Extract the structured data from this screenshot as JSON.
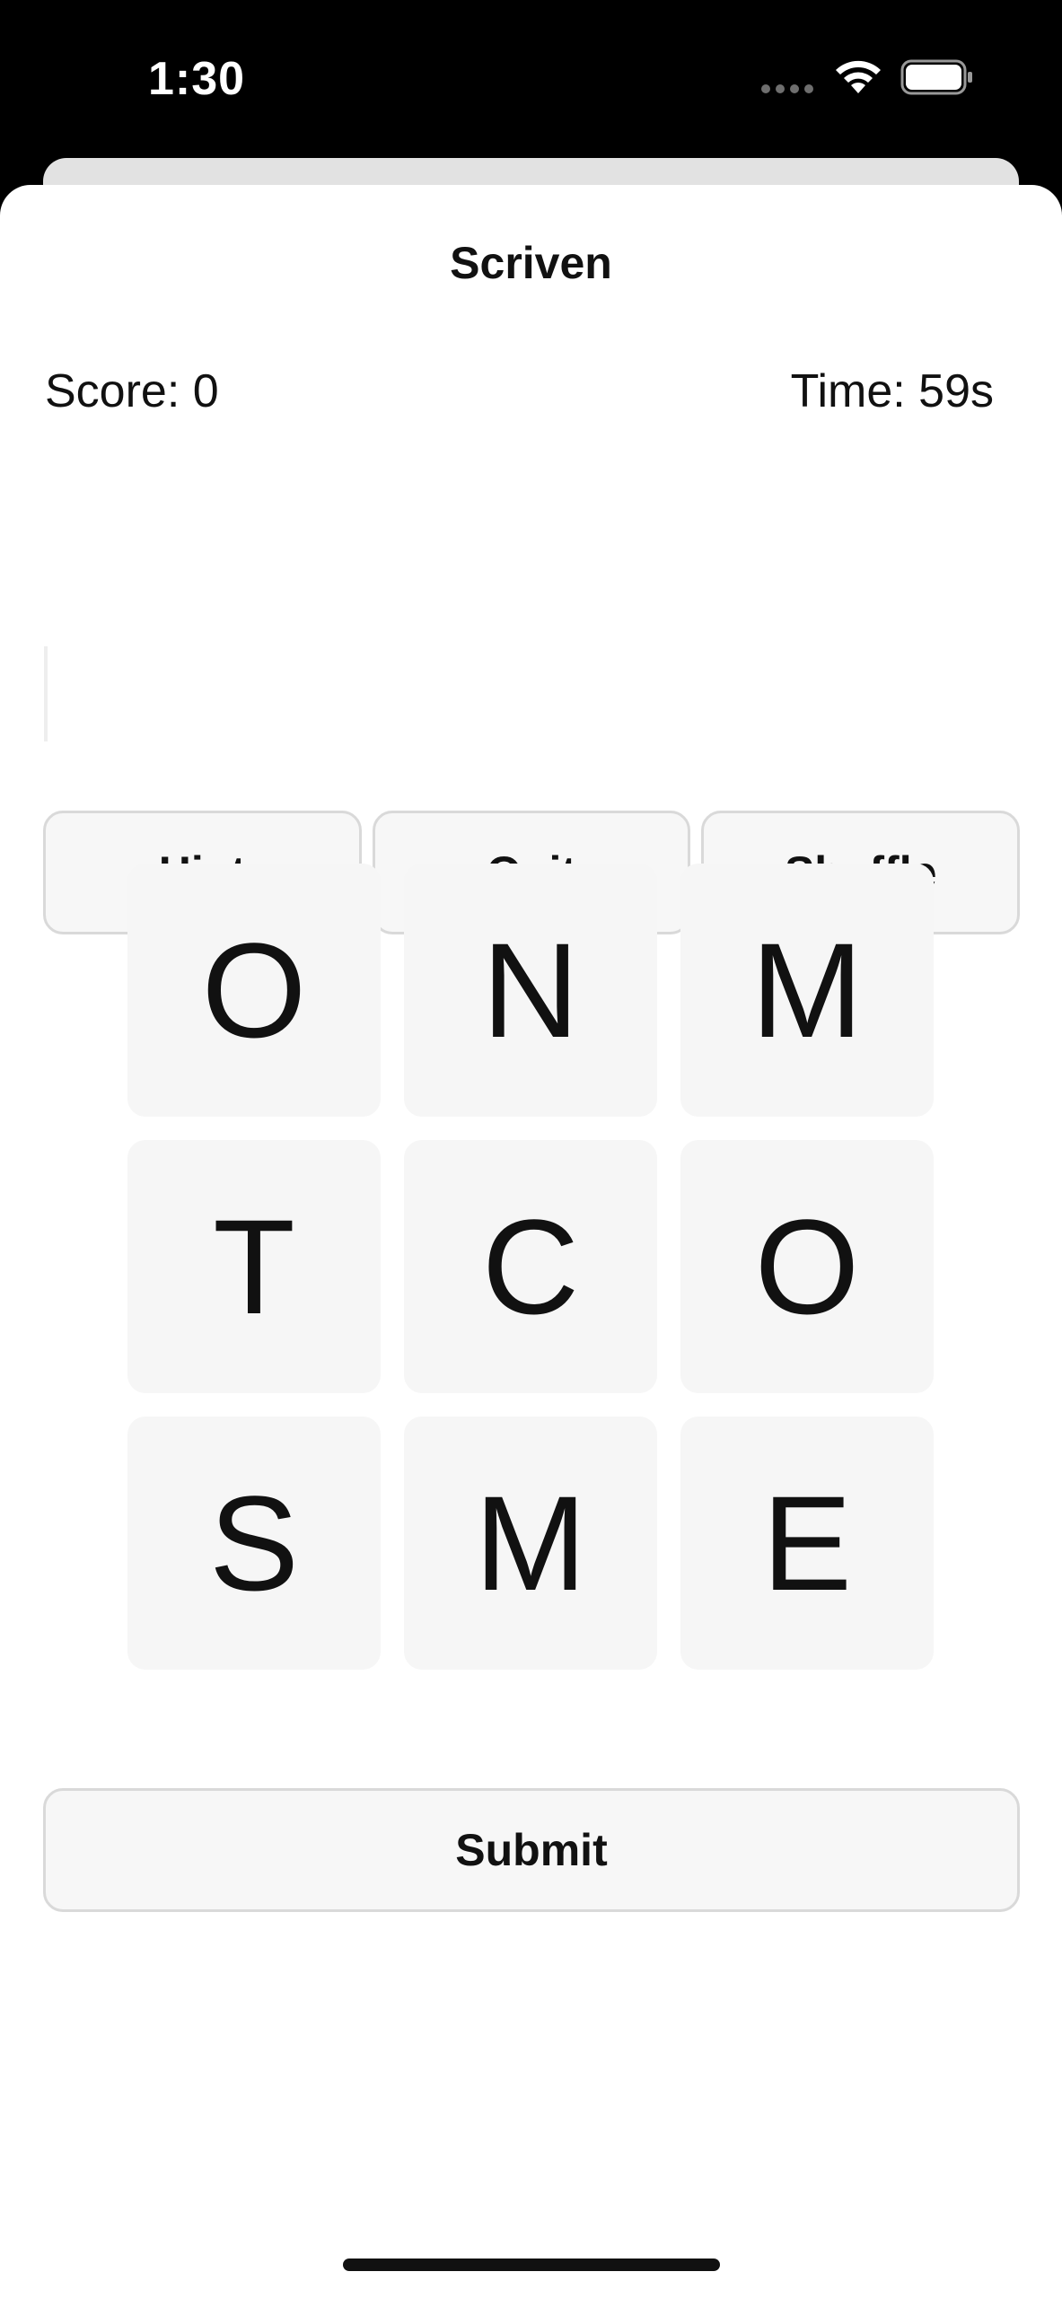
{
  "status_bar": {
    "time": "1:30"
  },
  "app": {
    "title": "Scriven"
  },
  "stats": {
    "score": "Score: 0",
    "time": "Time: 59s"
  },
  "input": {
    "value": "",
    "placeholder": ""
  },
  "actions": {
    "hint": "Hint",
    "quit": "Quit",
    "shuffle": "Shuffle"
  },
  "grid": {
    "tiles": [
      "O",
      "N",
      "M",
      "T",
      "C",
      "O",
      "S",
      "M",
      "E"
    ]
  },
  "submit": {
    "label": "Submit"
  },
  "colors": {
    "tile_bg": "#f6f6f6",
    "button_bg": "#f7f7f7",
    "button_border": "#d9d9d9",
    "text": "#111111"
  },
  "icons": {
    "wifi": "wifi-icon",
    "battery": "battery-icon"
  }
}
